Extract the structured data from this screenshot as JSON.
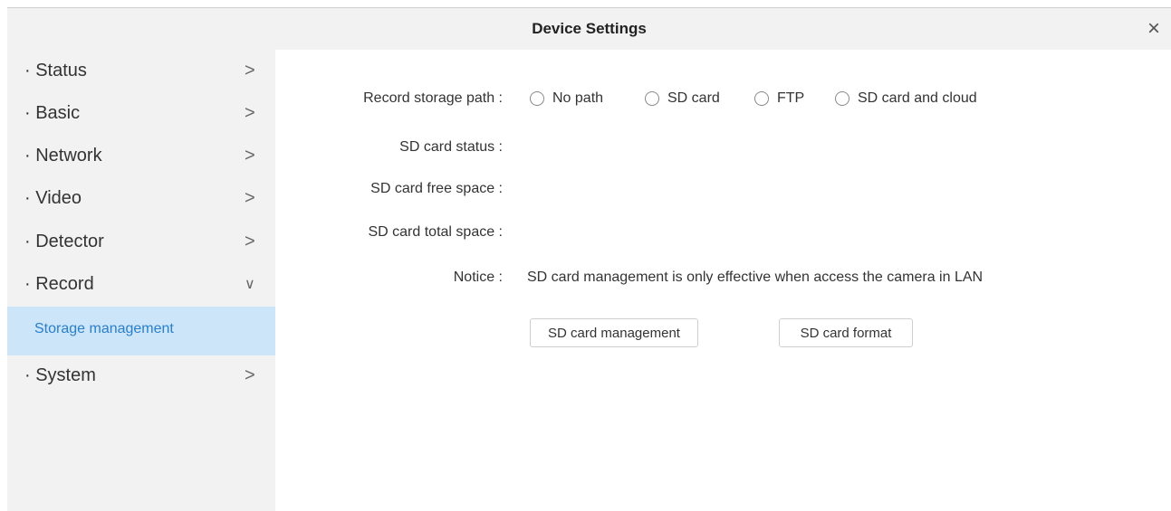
{
  "dialog": {
    "title": "Device Settings",
    "close_glyph": "×"
  },
  "sidebar": {
    "items": [
      {
        "label": "· Status",
        "chevron": ">"
      },
      {
        "label": "· Basic",
        "chevron": ">"
      },
      {
        "label": "· Network",
        "chevron": ">"
      },
      {
        "label": "· Video",
        "chevron": ">"
      },
      {
        "label": "· Detector",
        "chevron": ">"
      },
      {
        "label": "· Record",
        "chevron": "∨",
        "expanded": true
      },
      {
        "label": "· System",
        "chevron": ">"
      }
    ],
    "subitem": {
      "label": "Storage management",
      "selected": true
    }
  },
  "form": {
    "record_path_label": "Record storage path :",
    "record_path_options": [
      "No path",
      "SD card",
      "FTP",
      "SD card and cloud"
    ],
    "sd_status_label": "SD card status :",
    "sd_free_label": "SD card free space :",
    "sd_total_label": "SD card total space :",
    "notice_label": "Notice :",
    "notice_text": "SD card management is only effective when access the camera in LAN",
    "manage_button": "SD card management",
    "format_button": "SD card format"
  },
  "colors": {
    "sidebar_bg": "#f2f2f2",
    "selected_bg": "#cce5f8",
    "selected_text": "#2a7fc9"
  }
}
